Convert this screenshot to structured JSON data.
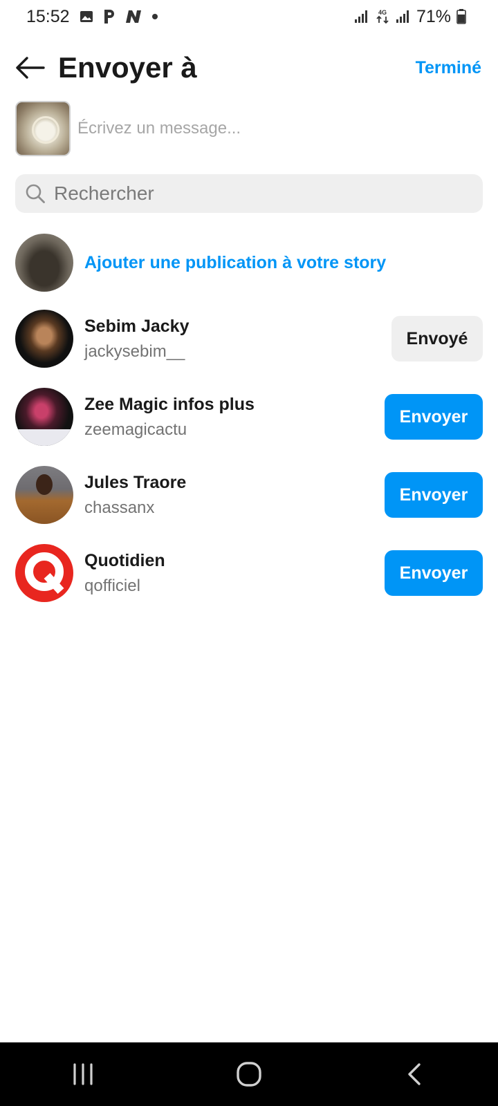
{
  "status_bar": {
    "time": "15:52",
    "notification_icons": [
      "image-icon",
      "p-app-icon",
      "n-app-icon",
      "dot-icon"
    ],
    "network": "4G",
    "battery": "71%"
  },
  "header": {
    "back_icon": "arrow-left-icon",
    "title": "Envoyer à",
    "done_label": "Terminé"
  },
  "compose": {
    "message_placeholder": "Écrivez un message..."
  },
  "search": {
    "placeholder": "Rechercher",
    "icon": "search-icon"
  },
  "story": {
    "label": "Ajouter une publication à votre story"
  },
  "contacts": [
    {
      "name": "Sebim Jacky",
      "handle": "jackysebim__",
      "button": "Envoyé",
      "state": "sent"
    },
    {
      "name": "Zee Magic infos plus",
      "handle": "zeemagicactu",
      "button": "Envoyer",
      "state": "send"
    },
    {
      "name": "Jules Traore",
      "handle": "chassanx",
      "button": "Envoyer",
      "state": "send"
    },
    {
      "name": "Quotidien",
      "handle": "qofficiel",
      "button": "Envoyer",
      "state": "send"
    }
  ],
  "nav_bar": {
    "buttons": [
      "recent-apps-icon",
      "home-icon",
      "back-icon"
    ]
  },
  "colors": {
    "accent": "#0095f6",
    "sent_button_bg": "#efefef",
    "search_bg": "#efefef",
    "nav_bar_bg": "#000000"
  }
}
